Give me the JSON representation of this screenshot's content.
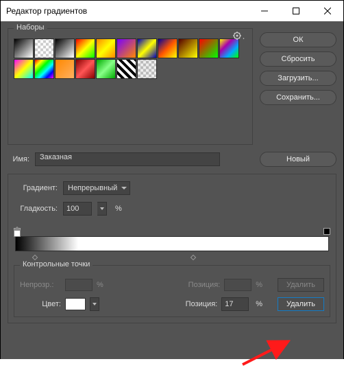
{
  "window": {
    "title": "Редактор градиентов"
  },
  "presets": {
    "legend": "Наборы"
  },
  "side": {
    "ok": "ОК",
    "reset": "Сбросить",
    "load": "Загрузить...",
    "save": "Сохранить..."
  },
  "name": {
    "label": "Имя:",
    "value": "Заказная",
    "new_btn": "Новый"
  },
  "gradient": {
    "type_label": "Градиент:",
    "type_value": "Непрерывный",
    "smooth_label": "Гладкость:",
    "smooth_value": "100",
    "percent": "%"
  },
  "ctrl": {
    "legend": "Контрольные точки",
    "opacity_label": "Непрозр.:",
    "position_label": "Позиция:",
    "delete": "Удалить",
    "color_label": "Цвет:",
    "position_value": "17"
  },
  "chart_data": {
    "type": "bar",
    "description": "Gradient preview bar with color stops and opacity stops",
    "opacity_stops": [
      {
        "position": 0,
        "opacity": 100
      },
      {
        "position": 100,
        "opacity": 100
      }
    ],
    "color_stops": [
      {
        "position": 0,
        "color": "#000000"
      },
      {
        "position": 17,
        "color": "#ffffff",
        "selected": true
      },
      {
        "position": 100,
        "color": "#ffffff"
      }
    ],
    "midpoints": [
      8,
      58
    ]
  },
  "swatches": [
    {
      "css": "linear-gradient(135deg,#000,#fff)"
    },
    {
      "css": "repeating-conic-gradient(#ccc 0 25%,#fff 0 50%) 0/8px 8px"
    },
    {
      "css": "linear-gradient(135deg,#000,#fff)"
    },
    {
      "css": "linear-gradient(135deg,#f00,#ff0,#0f0)"
    },
    {
      "css": "linear-gradient(135deg,#f80,#ff0,#f80)"
    },
    {
      "css": "linear-gradient(135deg,#70f,#f80)"
    },
    {
      "css": "linear-gradient(135deg,#00b,#ff0,#00b)"
    },
    {
      "css": "linear-gradient(135deg,#009,#f50,#ff0)"
    },
    {
      "css": "linear-gradient(135deg,#500,#ff0)"
    },
    {
      "css": "linear-gradient(135deg,#f00,#0f0)"
    },
    {
      "css": "linear-gradient(135deg,#ff0,#a0a,#0af,#0f0)"
    },
    {
      "css": "linear-gradient(135deg,#f0f,#ff0,#0ff)"
    },
    {
      "css": "linear-gradient(135deg,#f00,#ff0,#0f0,#0ff,#00f,#f0f)"
    },
    {
      "css": "linear-gradient(135deg,#f80,#ffb060)"
    },
    {
      "css": "linear-gradient(135deg,#800,#f55,#800)"
    },
    {
      "css": "linear-gradient(135deg,#0a0,#8f8,#0a0)"
    },
    {
      "css": "repeating-linear-gradient(45deg,#fff 0 4px,#000 4px 8px)"
    },
    {
      "css": "repeating-conic-gradient(#bbb 0 25%,#eee 0 50%) 0/8px 8px"
    }
  ]
}
